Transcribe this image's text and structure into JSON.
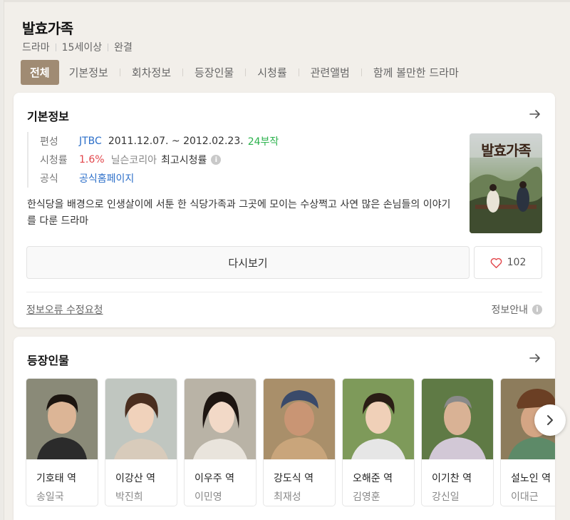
{
  "program": {
    "title": "발효가족",
    "meta": [
      "드라마",
      "15세이상",
      "완결"
    ]
  },
  "tabs": [
    "전체",
    "기본정보",
    "회차정보",
    "등장인물",
    "시청률",
    "관련앨범",
    "함께 볼만한 드라마"
  ],
  "basic_info": {
    "section_title": "기본정보",
    "broadcast_label": "편성",
    "channel": "JTBC",
    "period": "2011.12.07. ~ 2012.02.23.",
    "episodes": "24부작",
    "rating_label": "시청률",
    "rating_value": "1.6%",
    "rating_source": "닐슨코리아",
    "rating_note": "최고시청률",
    "official_label": "공식",
    "official_link": "공식홈페이지",
    "description": "한식당을 배경으로 인생살이에 서툰 한 식당가족과 그곳에 모이는 수상쩍고 사연 많은 손님들의 이야기를 다룬 드라마",
    "poster_text": "발효가족",
    "rewatch_label": "다시보기",
    "like_count": "102",
    "report_label": "정보오류 수정요청",
    "guide_label": "정보안내"
  },
  "cast": {
    "section_title": "등장인물",
    "people": [
      {
        "role": "기호태 역",
        "actor": "송일국"
      },
      {
        "role": "이강산 역",
        "actor": "박진희"
      },
      {
        "role": "이우주 역",
        "actor": "이민영"
      },
      {
        "role": "강도식 역",
        "actor": "최재성"
      },
      {
        "role": "오해준 역",
        "actor": "김영훈"
      },
      {
        "role": "이기찬 역",
        "actor": "강신일"
      },
      {
        "role": "설노인 역",
        "actor": "이대근"
      }
    ]
  },
  "colors": {
    "accent_tab": "#a08b73",
    "link_blue": "#2c6fc9",
    "episodes_green": "#2bb24c",
    "rating_red": "#e2464b"
  }
}
